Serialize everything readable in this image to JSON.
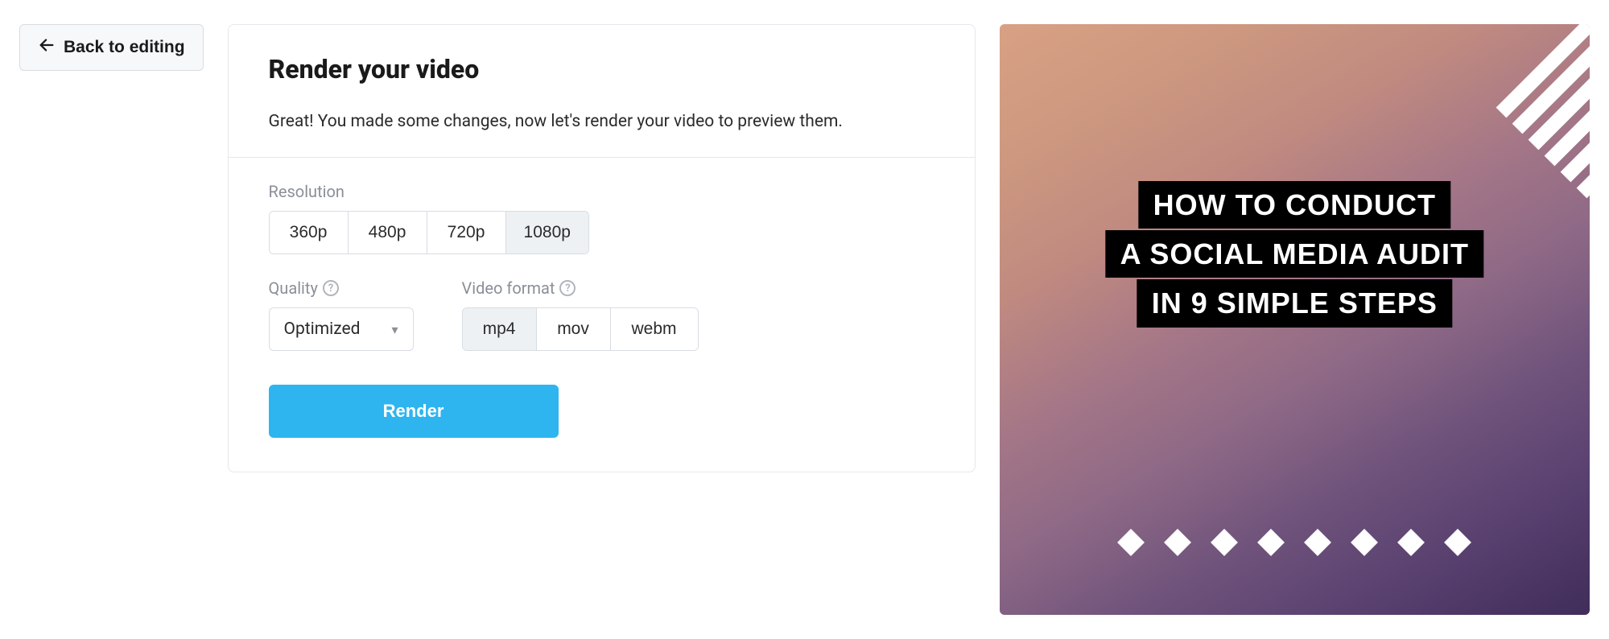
{
  "back_label": "Back to editing",
  "panel": {
    "title": "Render your video",
    "subtitle": "Great! You made some changes, now let's render your video to preview them."
  },
  "resolution": {
    "label": "Resolution",
    "options": [
      "360p",
      "480p",
      "720p",
      "1080p"
    ],
    "selected": "1080p"
  },
  "quality": {
    "label": "Quality",
    "value": "Optimized"
  },
  "format": {
    "label": "Video format",
    "options": [
      "mp4",
      "mov",
      "webm"
    ],
    "selected": "mp4"
  },
  "render_label": "Render",
  "preview": {
    "title_lines": [
      "HOW TO CONDUCT",
      "A SOCIAL MEDIA AUDIT",
      "IN 9 SIMPLE STEPS"
    ],
    "diamond_count": 8
  }
}
